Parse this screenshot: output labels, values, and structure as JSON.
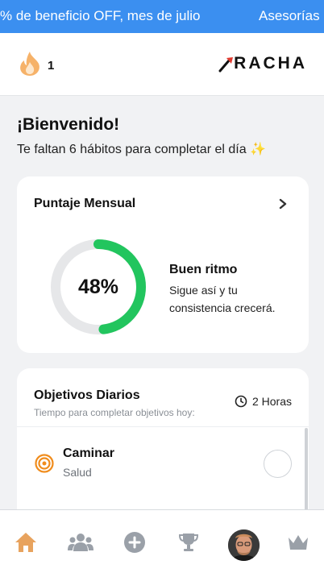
{
  "promo": {
    "text": "% de beneficio OFF, mes de julio",
    "link": "Asesorías"
  },
  "header": {
    "streak_count": "1",
    "logo_text": "RACHA",
    "streak_icon": "flame-icon",
    "accent": "#f59a3a"
  },
  "greeting": {
    "title": "¡Bienvenido!",
    "subtitle": "Te faltan 6 hábitos para completar el día ✨"
  },
  "score": {
    "title": "Puntaje Mensual",
    "percent_label": "48%",
    "progress": 0.48,
    "status_title": "Buen ritmo",
    "status_desc": "Sigue así y tu consistencia crecerá.",
    "progress_color": "#22c55e",
    "track_color": "#e6e7e9"
  },
  "goals": {
    "title": "Objetivos Diarios",
    "subtitle": "Tiempo para completar objetivos hoy:",
    "time": "2 Horas",
    "items": [
      {
        "name": "Caminar",
        "category": "Salud",
        "icon": "target-icon"
      }
    ]
  },
  "nav": {
    "items": [
      "home-icon",
      "community-icon",
      "add-icon",
      "trophy-icon",
      "profile-avatar",
      "crown-icon"
    ],
    "active_color": "#e8a35e",
    "inactive_color": "#9aa0a8"
  }
}
